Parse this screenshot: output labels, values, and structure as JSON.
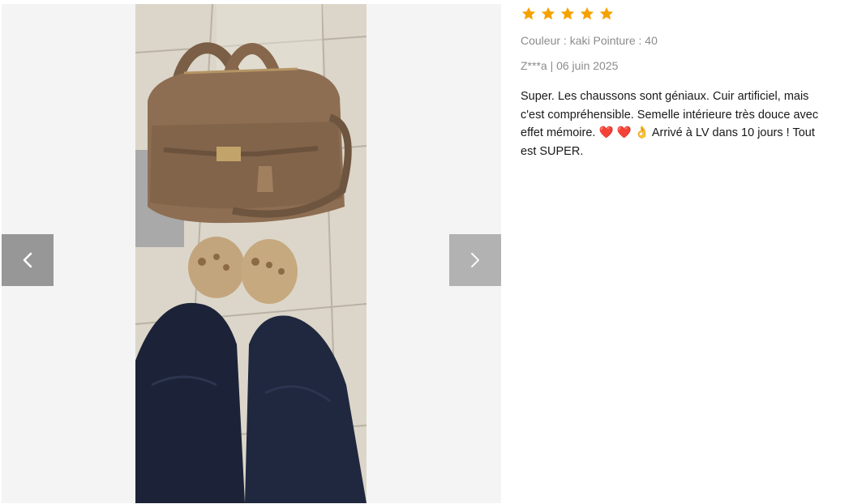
{
  "gallery": {
    "photo_alt": "Photo de l'avis client",
    "prev_icon": "chevron-left-icon",
    "next_icon": "chevron-right-icon"
  },
  "review": {
    "rating": 5,
    "star_color": "#f5a200",
    "variant_label": "Couleur : kaki Pointure : 40",
    "author_date": "Z***a | 06 juin 2025",
    "comment": "Super. Les chaussons sont géniaux. Cuir artificiel, mais c'est compréhensible. Semelle intérieure très douce avec effet mémoire. ❤️ ❤️ 👌 Arrivé à LV dans 10 jours ! Tout est SUPER."
  }
}
